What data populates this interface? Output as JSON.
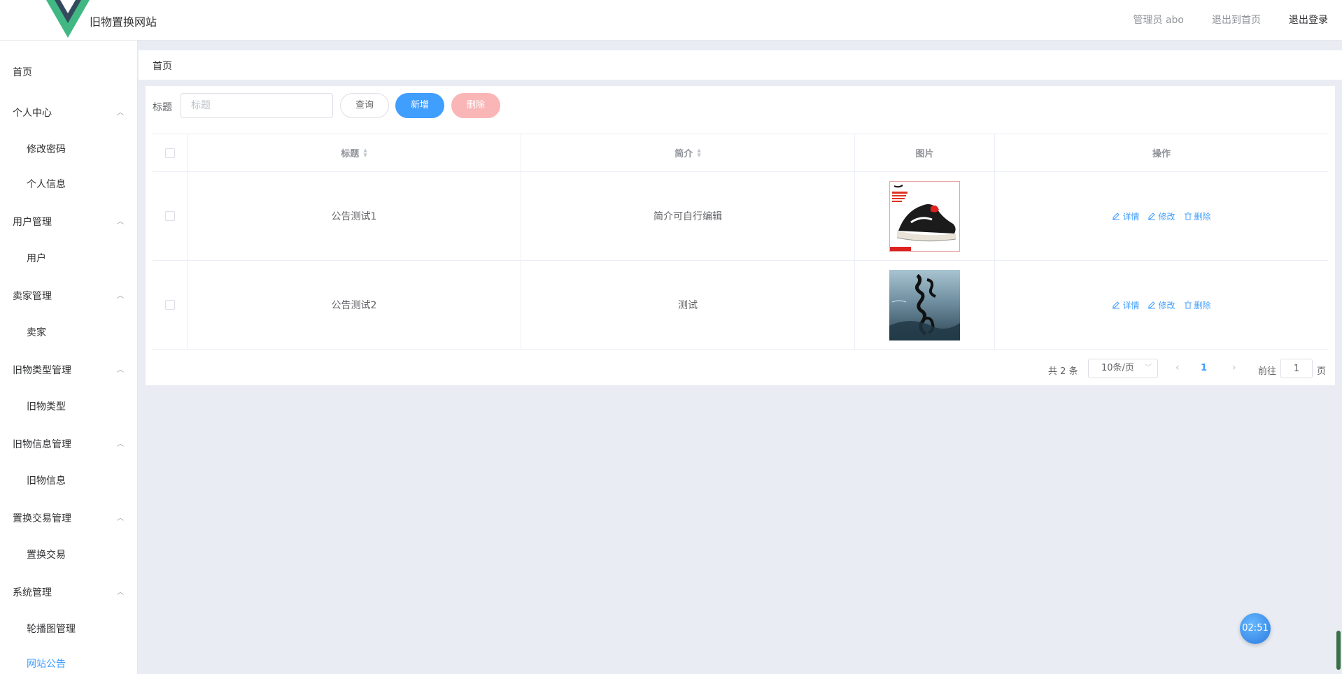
{
  "header": {
    "site_title": "旧物置换网站",
    "admin_label": "管理员 abo",
    "back_home": "退出到首页",
    "logout": "退出登录"
  },
  "sidebar": {
    "items": [
      {
        "label": "首页",
        "level": "top"
      },
      {
        "label": "个人中心",
        "level": "top",
        "expanded": true
      },
      {
        "label": "修改密码",
        "level": "sub"
      },
      {
        "label": "个人信息",
        "level": "sub"
      },
      {
        "label": "用户管理",
        "level": "top",
        "expanded": true
      },
      {
        "label": "用户",
        "level": "sub"
      },
      {
        "label": "卖家管理",
        "level": "top",
        "expanded": true
      },
      {
        "label": "卖家",
        "level": "sub"
      },
      {
        "label": "旧物类型管理",
        "level": "top",
        "expanded": true
      },
      {
        "label": "旧物类型",
        "level": "sub"
      },
      {
        "label": "旧物信息管理",
        "level": "top",
        "expanded": true
      },
      {
        "label": "旧物信息",
        "level": "sub"
      },
      {
        "label": "置换交易管理",
        "level": "top",
        "expanded": true
      },
      {
        "label": "置换交易",
        "level": "sub"
      },
      {
        "label": "系统管理",
        "level": "top",
        "expanded": true
      },
      {
        "label": "轮播图管理",
        "level": "sub"
      },
      {
        "label": "网站公告",
        "level": "sub",
        "active": true
      }
    ]
  },
  "breadcrumb": {
    "current": "首页"
  },
  "search": {
    "label": "标题",
    "placeholder": "标题",
    "value": "",
    "query_button": "查询",
    "add_button": "新增",
    "delete_button": "删除"
  },
  "table": {
    "columns": {
      "title": "标题",
      "intro": "简介",
      "image": "图片",
      "ops": "操作"
    },
    "rows": [
      {
        "title": "公告测试1",
        "intro": "简介可自行编辑",
        "image": "shoe-image"
      },
      {
        "title": "公告测试2",
        "intro": "测试",
        "image": "poster-image"
      }
    ],
    "actions": {
      "detail": "详情",
      "edit": "修改",
      "delete": "删除"
    }
  },
  "pagination": {
    "total": "共 2 条",
    "page_size": "10条/页",
    "current_page": "1",
    "goto_label": "前往",
    "goto_value": "1",
    "goto_suffix": "页"
  },
  "timer": "02:51",
  "colors": {
    "primary": "#409eff",
    "danger_disabled": "#fab6b6",
    "background": "#e9edf3"
  }
}
